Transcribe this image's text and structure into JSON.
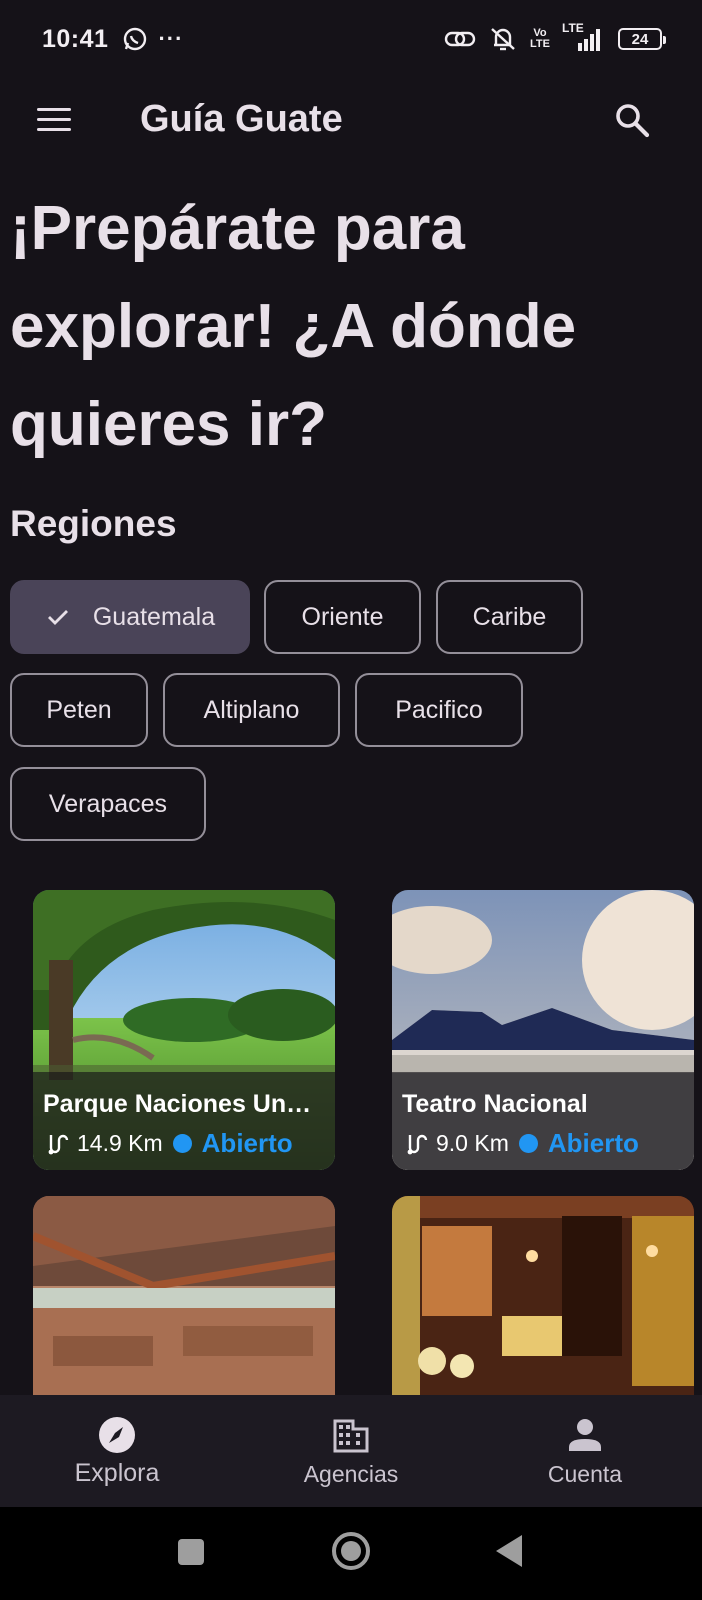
{
  "status_bar": {
    "time": "10:41",
    "overflow": "···",
    "volte_top": "Vo",
    "volte_bottom": "LTE",
    "lte": "LTE",
    "battery": "24",
    "icons": [
      "whatsapp-icon",
      "link-icon",
      "mute-icon",
      "volte-icon",
      "signal-icon",
      "battery-icon"
    ]
  },
  "app_bar": {
    "title": "Guía Guate",
    "icons": [
      "menu-icon",
      "search-icon"
    ]
  },
  "headline": "¡Prepárate para explorar! ¿A dónde quieres ir?",
  "regions": {
    "title": "Regiones",
    "chips": [
      {
        "label": "Guatemala",
        "selected": true
      },
      {
        "label": "Oriente",
        "selected": false
      },
      {
        "label": "Caribe",
        "selected": false
      },
      {
        "label": "Peten",
        "selected": false
      },
      {
        "label": "Altiplano",
        "selected": false
      },
      {
        "label": "Pacifico",
        "selected": false
      },
      {
        "label": "Verapaces",
        "selected": false
      }
    ]
  },
  "places": [
    {
      "name": "Parque Naciones Un…",
      "distance": "14.9 Km",
      "status": "Abierto",
      "image": "park-photo"
    },
    {
      "name": "Teatro Nacional",
      "distance": "9.0 Km",
      "status": "Abierto",
      "image": "theatre-photo"
    },
    {
      "name": "",
      "distance": "",
      "status": "",
      "image": "archaeological-site-photo"
    },
    {
      "name": "",
      "distance": "",
      "status": "",
      "image": "train-car-interior-photo"
    }
  ],
  "colors": {
    "background": "#151218",
    "selected_chip": "#4a4458",
    "open_status": "#2196f3",
    "nav_bar": "#1d1a22"
  },
  "bottom_nav": [
    {
      "label": "Explora",
      "icon": "compass-icon",
      "active": true
    },
    {
      "label": "Agencias",
      "icon": "building-icon",
      "active": false
    },
    {
      "label": "Cuenta",
      "icon": "person-icon",
      "active": false
    }
  ],
  "system_nav": [
    "recents-button",
    "home-button",
    "back-button"
  ]
}
